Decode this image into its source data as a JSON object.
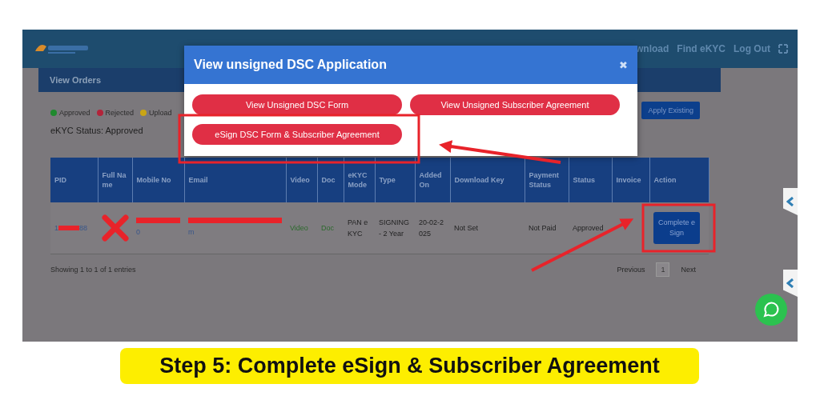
{
  "header": {
    "nav_links": [
      "wnload",
      "Find eKYC",
      "Log Out"
    ]
  },
  "panel": {
    "title": "View Orders",
    "legend": [
      {
        "label": "Approved",
        "color": "#1f8a2e"
      },
      {
        "label": "Rejected",
        "color": "#b3243a"
      },
      {
        "label": "Upload",
        "color": "#c9a514"
      }
    ],
    "apply_button": "Apply Existing",
    "ekyc_status": "eKYC Status: Approved"
  },
  "table": {
    "columns": [
      "PID",
      "Full Name",
      "Mobile No",
      "Email",
      "Video",
      "Doc",
      "eKYC Mode",
      "Type",
      "Added On",
      "Download Key",
      "Payment Status",
      "Status",
      "Invoice",
      "Action"
    ],
    "rows": [
      {
        "cells": [
          {
            "kind": "link",
            "text": "1",
            "text_after": "88",
            "redacted": true
          },
          {
            "kind": "crossed"
          },
          {
            "kind": "link",
            "text": "0",
            "redacted": true
          },
          {
            "kind": "link",
            "text": "m",
            "redacted": true
          },
          {
            "kind": "green",
            "text": "Video"
          },
          {
            "kind": "green",
            "text": "Doc"
          },
          {
            "kind": "text",
            "text": "PAN eKYC"
          },
          {
            "kind": "text",
            "text": "SIGNING - 2 Year"
          },
          {
            "kind": "text",
            "text": "20-02-2025"
          },
          {
            "kind": "text",
            "text": "Not Set"
          },
          {
            "kind": "text",
            "text": "Not Paid"
          },
          {
            "kind": "text",
            "text": "Approved"
          },
          {
            "kind": "empty"
          },
          {
            "kind": "button",
            "text": "Complete eSign"
          }
        ]
      }
    ]
  },
  "footer": {
    "info": "Showing 1 to 1 of 1 entries",
    "pages": [
      {
        "label": "Previous",
        "selected": false
      },
      {
        "label": "1",
        "selected": true
      },
      {
        "label": "Next",
        "selected": false
      }
    ]
  },
  "modal": {
    "title": "View unsigned DSC Application",
    "close": "✖",
    "buttons": [
      "View Unsigned DSC Form",
      "View Unsigned Subscriber Agreement",
      "eSign DSC Form & Subscriber Agreement"
    ]
  },
  "caption": "Step 5: Complete eSign & Subscriber Agreement"
}
